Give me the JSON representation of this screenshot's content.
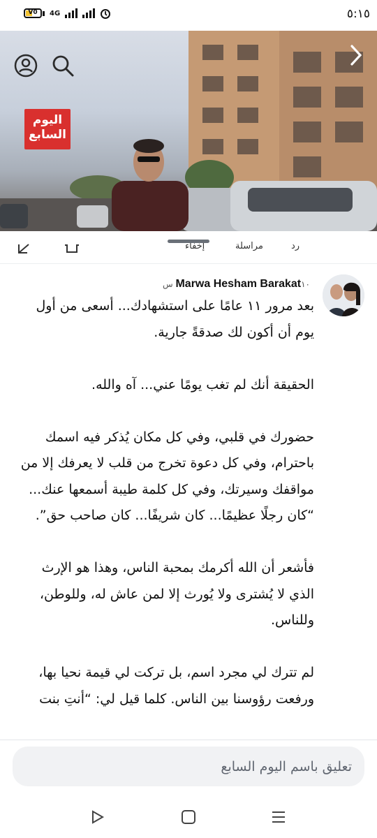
{
  "status_bar": {
    "time": "٥:١٥",
    "battery_label": "V0",
    "network": "4G"
  },
  "hero": {
    "logo_line1": "اليوم",
    "logo_line2": "السابع"
  },
  "actions": {
    "reply": "رد",
    "message": "مراسلة",
    "hide": "إخفاء"
  },
  "comment": {
    "author": "Marwa Hesham Barakat",
    "time": "١٠ س",
    "paragraphs": [
      "بعد مرور ١١ عامًا على استشهادك... أسعى من أول يوم أن أكون لك صدقةً جارية.",
      "الحقيقة أنك لم تغب يومًا عني... آه والله.",
      "حضورك في قلبي، وفي كل مكان يُذكر فيه اسمك باحترام، وفي كل دعوة تخرج من قلب لا يعرفك إلا من مواقفك وسيرتك، وفي كل كلمة طيبة أسمعها عنك... “كان رجلًا عظيمًا... كان شريفًا... كان صاحب حق”.",
      "فأشعر أن الله أكرمك بمحبة الناس، وهذا هو الإرث الذي لا يُشترى ولا يُورث إلا لمن عاش له، وللوطن، وللناس.",
      "لم تترك لي مجرد اسم، بل تركت لي قيمة نحيا بها، ورفعت رؤوسنا بين الناس. كلما قيل لي: “أنتِ بنت"
    ]
  },
  "composer": {
    "placeholder": "تعليق باسم اليوم السابع"
  },
  "colors": {
    "logo_red": "#d9302e",
    "battery_yellow": "#f2c230",
    "input_bg": "#f1f2f4"
  }
}
